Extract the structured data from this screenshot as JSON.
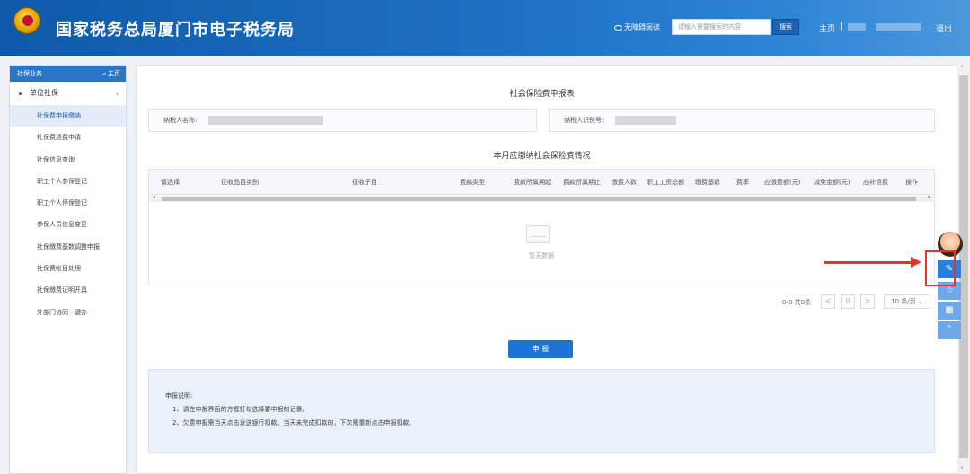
{
  "header": {
    "title": "国家税务总局厦门市电子税务局",
    "accessibility": "无障碍阅读",
    "search_placeholder": "请输入需要搜索的内容",
    "search_button": "搜索",
    "home": "主页",
    "separator": "|",
    "logout": "退出"
  },
  "sidebar": {
    "head": "社保业务",
    "home": "主页",
    "group": "单位社保",
    "items": [
      "社保费申报缴纳",
      "社保费退费申请",
      "社保信息查询",
      "职工个人参保登记",
      "职工个人停保登记",
      "参保人员信息变更",
      "社保缴费基数调整申报",
      "社保费帐目处理",
      "社保缴费证明开具",
      "外部门协同一键办"
    ],
    "active_index": 0
  },
  "form": {
    "title": "社会保险费申报表",
    "taxpayer_name_label": "纳税人名称:",
    "taxpayer_id_label": "纳税人识别号:",
    "section_title": "本月应缴纳社会保险费情况"
  },
  "table": {
    "columns": [
      "请选择",
      "征收品目类别",
      "征收子目",
      "费款类型",
      "费款所属期起",
      "费款所属期止",
      "缴费人数",
      "职工工资总额",
      "缴费基数",
      "费率",
      "应缴费额(元)",
      "减免金额(元)",
      "应补退费",
      "操作"
    ],
    "empty_text": "暂无数据"
  },
  "pager": {
    "info": "0-0 共0条",
    "prev": "<",
    "page": "0",
    "next": ">",
    "size": "10 条/页"
  },
  "submit_button": "申 报",
  "notes": {
    "title": "申报说明:",
    "items": [
      "1、请在申报界面的方框打勾选择要申报的记录。",
      "2、欠费申报需当天点击发送银行扣款。当天未完成扣款的，下次需重新点击申报扣款。"
    ]
  },
  "float_toolbar": {
    "icons": [
      "avatar-icon",
      "document-search-icon",
      "star-icon",
      "calculator-icon",
      "chevron-up-icon"
    ]
  },
  "colors": {
    "header_blue": "#1f72c4",
    "accent": "#1d74d6",
    "annotation_red": "#e8332a"
  }
}
